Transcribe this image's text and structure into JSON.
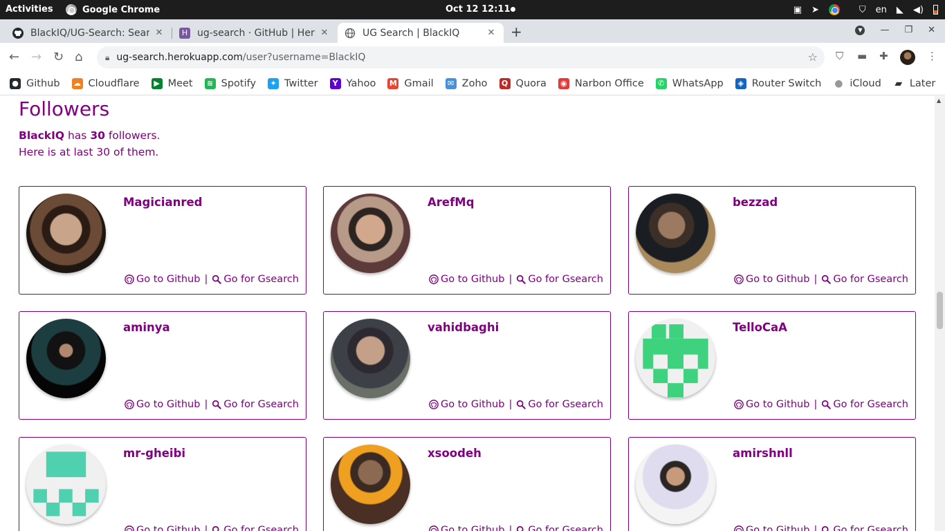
{
  "system_bar": {
    "activities": "Activities",
    "app_name": "Google Chrome",
    "clock": "Oct 12  12:11",
    "language": "en"
  },
  "tabs": [
    {
      "title": "BlackIQ/UG-Search: Searc",
      "favicon": "github-icon",
      "active": false
    },
    {
      "title": "ug-search · GitHub | Hero",
      "favicon": "heroku-icon",
      "active": false
    },
    {
      "title": "UG Search | BlackIQ",
      "favicon": "globe-icon",
      "active": true
    }
  ],
  "address_bar": {
    "host": "ug-search.herokuapp.com",
    "path": "/user?username=BlackIQ"
  },
  "bookmarks": [
    {
      "label": "Github",
      "icon": "github-icon",
      "color": "#24292e"
    },
    {
      "label": "Cloudflare",
      "icon": "cloud-icon",
      "color": "#f38020"
    },
    {
      "label": "Meet",
      "icon": "meet-icon",
      "color": "#00832d"
    },
    {
      "label": "Spotify",
      "icon": "spotify-icon",
      "color": "#1db954"
    },
    {
      "label": "Twitter",
      "icon": "twitter-icon",
      "color": "#1da1f2"
    },
    {
      "label": "Yahoo",
      "icon": "yahoo-icon",
      "color": "#6001d2"
    },
    {
      "label": "Gmail",
      "icon": "gmail-icon",
      "color": "#ea4335"
    },
    {
      "label": "Zoho",
      "icon": "zoho-icon",
      "color": "#4a90d9"
    },
    {
      "label": "Quora",
      "icon": "quora-icon",
      "color": "#b92b27"
    },
    {
      "label": "Narbon Office",
      "icon": "narbon-icon",
      "color": "#e53935"
    },
    {
      "label": "WhatsApp",
      "icon": "whatsapp-icon",
      "color": "#25d366"
    },
    {
      "label": "Router Switch",
      "icon": "router-icon",
      "color": "#1565c0"
    },
    {
      "label": "iCloud",
      "icon": "apple-icon",
      "color": "#999999"
    },
    {
      "label": "Later",
      "icon": "folder-icon",
      "color": "#333333"
    }
  ],
  "page": {
    "heading": "Followers",
    "user": "BlackIQ",
    "has_word": "has",
    "count": "30",
    "followers_word": "followers.",
    "subtitle": "Here is at last 30 of them.",
    "accent_color": "#800080",
    "github_link": "Go to Github",
    "gsearch_link": "Go for Gsearch",
    "link_separator": "|",
    "followers": [
      {
        "username": "Magicianred"
      },
      {
        "username": "ArefMq"
      },
      {
        "username": "bezzad"
      },
      {
        "username": "aminya"
      },
      {
        "username": "vahidbaghi"
      },
      {
        "username": "TelloCaA"
      },
      {
        "username": "mr-gheibi"
      },
      {
        "username": "xsoodeh"
      },
      {
        "username": "amirshnll"
      }
    ]
  }
}
